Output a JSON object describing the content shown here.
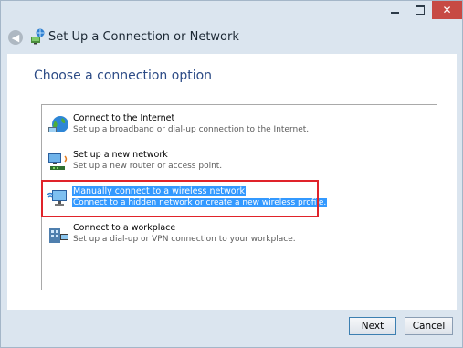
{
  "window": {
    "title": "Set Up a Connection or Network",
    "controls": {
      "minimize": "",
      "maximize": "",
      "close": "✕"
    }
  },
  "header": {
    "back": "◀",
    "title": "Set Up a Connection or Network"
  },
  "main": {
    "heading": "Choose a connection option",
    "options": [
      {
        "title": "Connect to the Internet",
        "description": "Set up a broadband or dial-up connection to the Internet.",
        "icon": "globe-network-icon",
        "selected": false
      },
      {
        "title": "Set up a new network",
        "description": "Set up a new router or access point.",
        "icon": "router-computer-icon",
        "selected": false
      },
      {
        "title": "Manually connect to a wireless network",
        "description": "Connect to a hidden network or create a new wireless profile.",
        "icon": "wireless-computer-icon",
        "selected": true
      },
      {
        "title": "Connect to a workplace",
        "description": "Set up a dial-up or VPN connection to your workplace.",
        "icon": "workplace-icon",
        "selected": false
      }
    ]
  },
  "footer": {
    "next": "Next",
    "cancel": "Cancel"
  },
  "colors": {
    "heading": "#2c4b86",
    "selection": "#3399ff",
    "highlight_frame": "#e0232a",
    "close_button": "#c74a44"
  }
}
